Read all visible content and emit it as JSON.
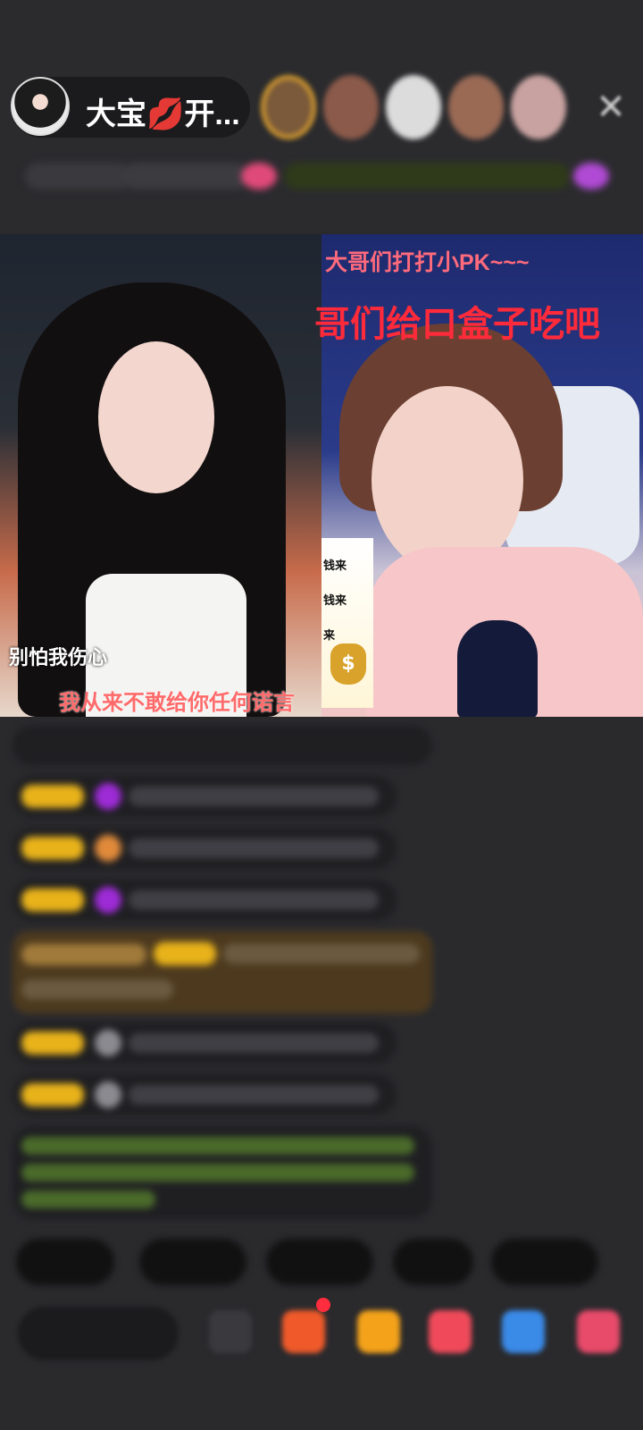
{
  "header": {
    "host_name": "大宝💋开...",
    "close_icon": "close-icon"
  },
  "video": {
    "left_caption_1": "别怕我伤心",
    "left_caption_2": "我从来不敢给你任何诺言",
    "right_caption_1": "大哥们打打小PK~~~",
    "right_caption_2": "哥们给口盒子吃吧",
    "money_banner_lines": [
      "钱来",
      "钱来",
      "来"
    ],
    "money_bag_symbol": "$"
  },
  "colors": {
    "background": "#2a2a2d",
    "accent_gold": "#d49a30",
    "caption_red": "#ff2a3a",
    "chat_highlight": "#4d3a1e"
  },
  "icons": [
    "close-icon",
    "money-bag-icon",
    "gift-icon",
    "crown-icon",
    "heart-icon"
  ]
}
